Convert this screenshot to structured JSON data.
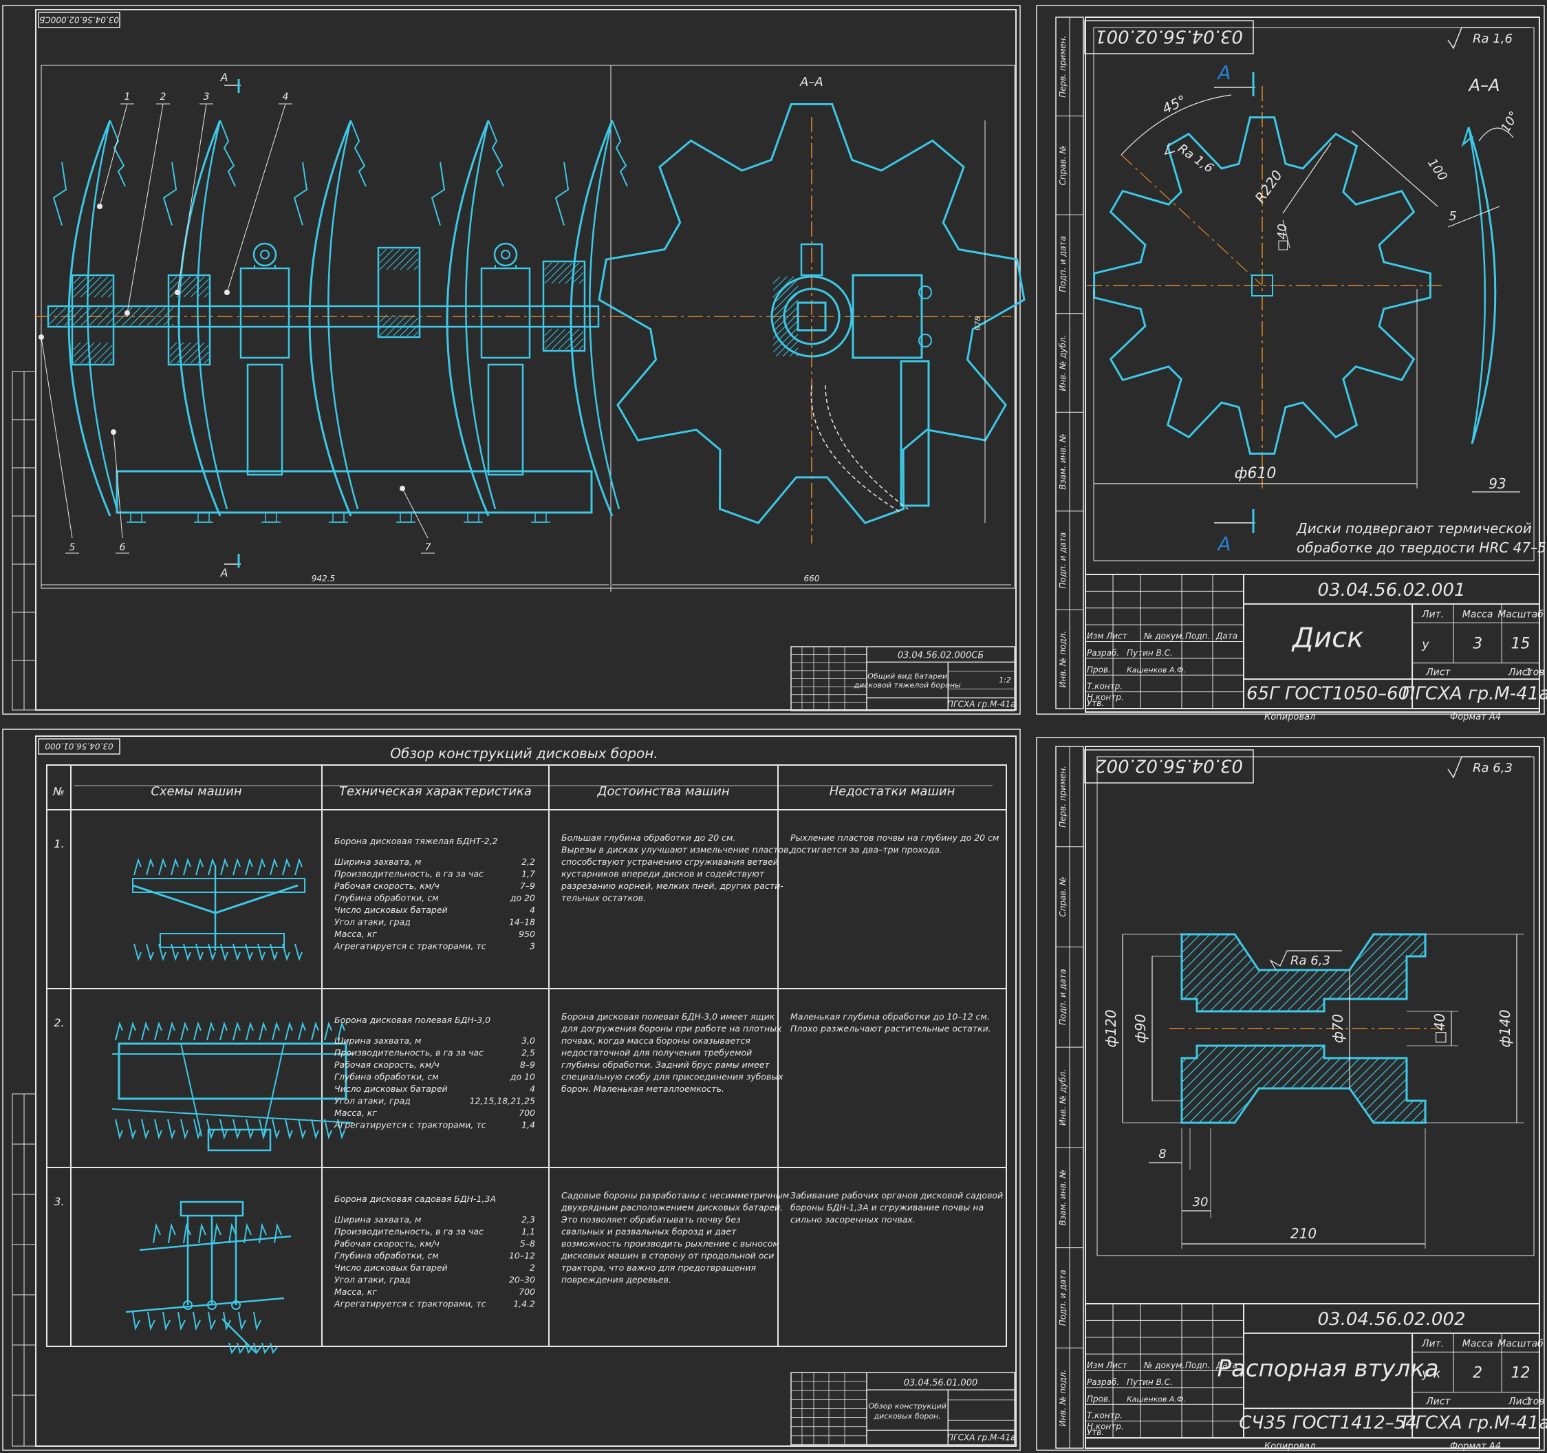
{
  "colors": {
    "background": "#2b2b2b",
    "outline": "#3cc8e6",
    "text": "#e8e8e8",
    "axis": "#e08a2a",
    "marker": "#2a7fd6"
  },
  "sheet_tl": {
    "code_mirrored": "03.04.56.02.000СБ",
    "section_label": "А–А",
    "cut_letter": "А",
    "leaders": [
      "1",
      "2",
      "3",
      "4",
      "5",
      "6",
      "7"
    ],
    "dim_length": "942.5",
    "dim_width": "660",
    "dim_height": "678",
    "stamp_code": "03.04.56.02.000СБ",
    "stamp_title": "Общий вид батареи дисковой тяжелой бороны",
    "stamp_org": "ПГСХА гр.М-41а",
    "stamp_scale": "1:2"
  },
  "sheet_tr": {
    "code_mirrored": "03.04.56.02.001",
    "roughness": "Ra 1,6",
    "section_label": "А–А",
    "cut_letter": "А",
    "dims": {
      "angle45": "45°",
      "ra": "Ra 1,6",
      "r220": "R220",
      "d40": "□40",
      "d100": "100",
      "d610": "ф610",
      "a10": "10°",
      "d5": "5",
      "d93": "93"
    },
    "note1": "Диски подвергают термической",
    "note2": "обработке до твердости HRC 47–59",
    "stamp": {
      "code": "03.04.56.02.001",
      "title": "Диск",
      "material": "65Г ГОСТ1050–60",
      "org": "ПГСХА гр.М-41а",
      "lit_label": "Лит.",
      "mass_label": "Масса",
      "scale_label": "Масштаб",
      "lit": "у",
      "mass": "3",
      "scale": "15",
      "sheet_label": "Лист",
      "sheets_label": "Листов",
      "sheets": "1",
      "rows": [
        "Изм Лист",
        "№ докум.",
        "Подп.",
        "Дата"
      ],
      "razrab": "Разраб.",
      "razrab_name": "Путин В.С.",
      "prov": "Пров.",
      "prov_name": "Кашенков А.Ф.",
      "tkontr": "Т.контр.",
      "nkontr": "Н.контр.",
      "utv": "Утв.",
      "kopir": "Копировал",
      "format": "Формат  А4"
    },
    "side_labels": [
      "Перв. примен.",
      "Справ. №",
      "Подп. и дата",
      "Инв. № дубл.",
      "Взам. инв. №",
      "Подп. и дата",
      "Инв. № подл."
    ]
  },
  "sheet_bl": {
    "code_mirrored": "03.04.56.01.000",
    "title": "Обзор конструкций дисковых борон.",
    "headers": [
      "№",
      "Схемы машин",
      "Техническая характеристика",
      "Достоинства машин",
      "Недостатки машин"
    ],
    "rows": [
      {
        "num": "1.",
        "name": "Борона дисковая тяжелая БДНТ-2,2",
        "specs": [
          [
            "Ширина захвата, м",
            "2,2"
          ],
          [
            "Производительность, в га за час",
            "1,7"
          ],
          [
            "Рабочая скорость, км/ч",
            "7–9"
          ],
          [
            "Глубина обработки, см",
            "до 20"
          ],
          [
            "Число дисковых батарей",
            "4"
          ],
          [
            "Угол атаки, град",
            "14–18"
          ],
          [
            "Масса, кг",
            "950"
          ],
          [
            "Агрегатируется с тракторами, тс",
            "3"
          ]
        ],
        "pros": [
          "Большая глубина обработки до 20 см.",
          "Вырезы в дисках улучшают измельчение пластов,",
          "способствуют устранению сгруживания ветвей",
          "кустарников впереди дисков и содействуют",
          "разрезанию корней, мелких пней, других расти-",
          "тельных остатков."
        ],
        "cons": [
          "Рыхление пластов почвы на глубину до 20 см",
          "достигается за два–три прохода."
        ]
      },
      {
        "num": "2.",
        "name": "Борона дисковая полевая БДН-3,0",
        "specs": [
          [
            "Ширина захвата, м",
            "3,0"
          ],
          [
            "Производительность, в га за час",
            "2,5"
          ],
          [
            "Рабочая скорость, км/ч",
            "8–9"
          ],
          [
            "Глубина обработки, см",
            "до 10"
          ],
          [
            "Число дисковых батарей",
            "4"
          ],
          [
            "Угол атаки, град",
            "12,15,18,21,25"
          ],
          [
            "Масса, кг",
            "700"
          ],
          [
            "Агрегатируется с тракторами, тс",
            "1,4"
          ]
        ],
        "pros": [
          "Борона дисковая полевая БДН-3,0 имеет ящик",
          "для догружения бороны при работе на плотных",
          "почвах, когда масса бороны оказывается",
          "недостаточной для получения требуемой",
          "глубины обработки. Задний брус рамы имеет",
          "специальную скобу для присоединения зубовых",
          "борон. Маленькая металлоемкость."
        ],
        "cons": [
          "Маленькая глубина обработки до 10–12 см.",
          "Плохо разжельчают растительные остатки."
        ]
      },
      {
        "num": "3.",
        "name": "Борона дисковая садовая БДН-1,3А",
        "specs": [
          [
            "Ширина захвата, м",
            "2,3"
          ],
          [
            "Производительность, в га за час",
            "1,1"
          ],
          [
            "Рабочая скорость, км/ч",
            "5–8"
          ],
          [
            "Глубина обработки, см",
            "10–12"
          ],
          [
            "Число дисковых батарей",
            "2"
          ],
          [
            "Угол атаки, град",
            "20–30"
          ],
          [
            "Масса, кг",
            "700"
          ],
          [
            "Агрегатируется с тракторами, тс",
            "1,4.2"
          ]
        ],
        "pros": [
          "Садовые бороны разработаны с несимметричным",
          "двухрядным расположением дисковых батарей.",
          "Это позволяет обрабатывать почву без",
          "свальных и развальных борозд и дает",
          "возможность производить рыхление с выносом",
          "дисковых машин в сторону от продольной оси",
          "трактора, что важно для предотвращения",
          "повреждения деревьев."
        ],
        "cons": [
          "Забивание рабочих органов дисковой садовой",
          "бороны БДН-1,3А и сгруживание почвы на",
          "сильно засоренных почвах."
        ]
      }
    ],
    "stamp_code": "03.04.56.01.000",
    "stamp_title": "Обзор конструкций дисковых борон.",
    "stamp_org": "ПГСХА гр.М-41а"
  },
  "sheet_br": {
    "code_mirrored": "03.04.56.02.002",
    "roughness": "Ra 6,3",
    "dims": {
      "ra": "Ra 6,3",
      "d120": "ф120",
      "d90": "ф90",
      "d70": "ф70",
      "d40": "□40",
      "d140": "ф140",
      "d8": "8",
      "d30": "30",
      "d210": "210"
    },
    "stamp": {
      "code": "03.04.56.02.002",
      "title": "Распорная втулка",
      "material": "СЧ35 ГОСТ1412–54",
      "org": "ПГСХА гр.М-41а",
      "lit_label": "Лит.",
      "mass_label": "Масса",
      "scale_label": "Масштаб",
      "lit": "у к",
      "mass": "2",
      "scale": "12",
      "sheet_label": "Лист",
      "sheets_label": "Листов",
      "sheets": "1",
      "rows": [
        "Изм Лист",
        "№ докум.",
        "Подп.",
        "Дата"
      ],
      "razrab": "Разраб.",
      "razrab_name": "Путин В.С.",
      "prov": "Пров.",
      "prov_name": "Кашенков А.Ф.",
      "tkontr": "Т.контр.",
      "nkontr": "Н.контр.",
      "utv": "Утв.",
      "kopir": "Копировал",
      "format": "Формат  А4"
    },
    "side_labels": [
      "Перв. примен.",
      "Справ. №",
      "Подп. и дата",
      "Инв. № дубл.",
      "Взам. инв. №",
      "Подп. и дата",
      "Инв. № подл."
    ]
  }
}
